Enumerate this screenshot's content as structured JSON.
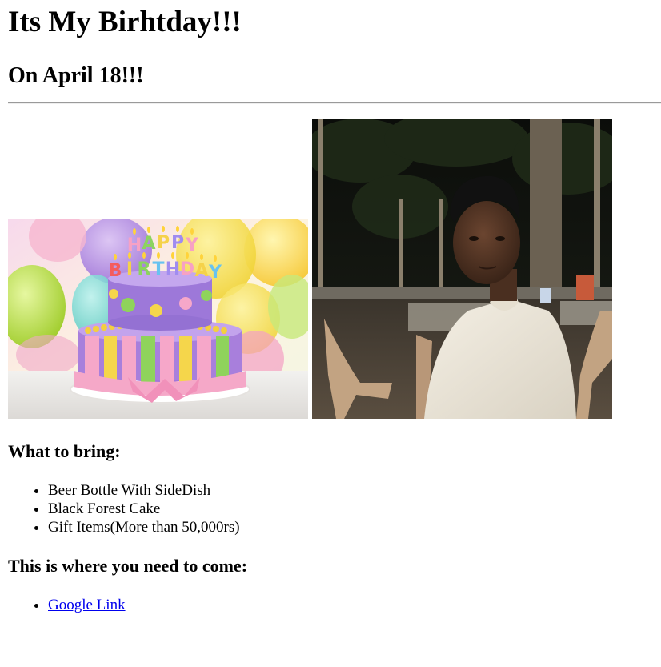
{
  "heading": "Its My Birhtday!!!",
  "subheading": "On April 18!!!",
  "images": {
    "cake_alt": "Birthday cake with candles spelling HAPPY BIRTHDAY",
    "cake_candle_letters": "HAPPY BIRTHDAY",
    "person_alt": "Photo of a young man sitting outdoors at night"
  },
  "bring": {
    "title": "What to bring:",
    "items": [
      "Beer Bottle With SideDish",
      "Black Forest Cake",
      "Gift Items(More than 50,000rs)"
    ]
  },
  "location": {
    "title": "This is where you need to come:",
    "link_label": "Google Link"
  },
  "colors": {
    "link": "#0000ee",
    "rule": "#9a9a9a"
  }
}
